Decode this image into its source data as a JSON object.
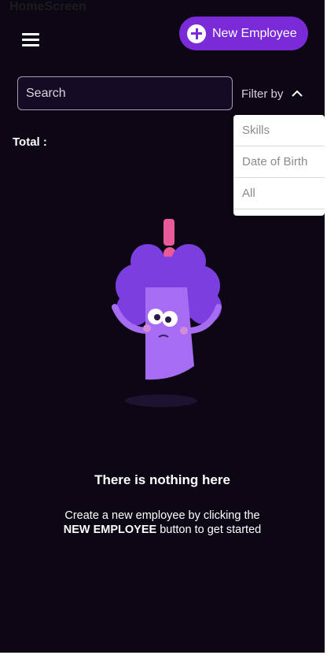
{
  "screen": {
    "label": "HomeScreen"
  },
  "header": {
    "new_employee_label": "New Employee"
  },
  "search": {
    "placeholder": "Search"
  },
  "filter": {
    "label": "Filter by",
    "options": [
      "Skills",
      "Date of Birth",
      "All"
    ]
  },
  "summary": {
    "total_label": "Total :"
  },
  "empty_state": {
    "title": "There is nothing here",
    "description_line1": "Create a new employee by clicking the",
    "description_emphasis": "NEW EMPLOYEE",
    "description_line2_rest": " button to get started"
  },
  "colors": {
    "background": "#0d0614",
    "accent": "#7a2ad6",
    "character": "#7b3fe0",
    "exclamation": "#e85a9a"
  }
}
